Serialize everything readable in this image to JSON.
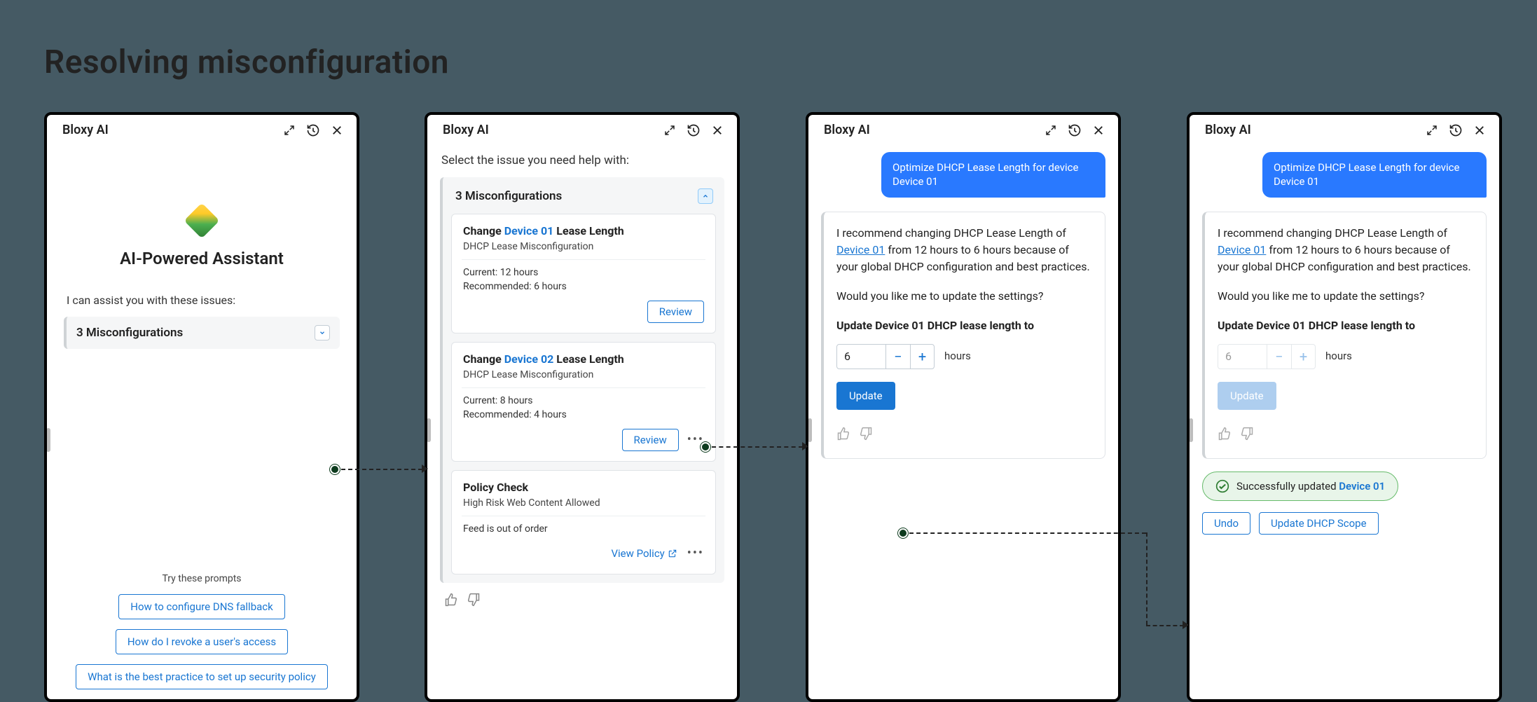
{
  "page_title": "Resolving misconfiguration",
  "header_title": "Bloxy AI",
  "panel1": {
    "assist_title": "AI-Powered Assistant",
    "assist_intro": "I can assist you with these issues:",
    "dropdown_label": "3 Misconfigurations",
    "prompts_heading": "Try these prompts",
    "prompts": [
      "How to configure DNS fallback",
      "How do I revoke a user's access",
      "What is the best practice to set up security policy"
    ]
  },
  "panel2": {
    "select_issue": "Select the issue you need help with:",
    "group_title": "3 Misconfigurations",
    "card1": {
      "pre": "Change ",
      "device": "Device 01",
      "post": " Lease Length",
      "sub": "DHCP Lease Misconfiguration",
      "current": "Current: 12 hours",
      "rec": "Recommended: 6 hours",
      "action": "Review"
    },
    "card2": {
      "pre": "Change ",
      "device": "Device 02",
      "post": " Lease Length",
      "sub": "DHCP Lease Misconfiguration",
      "current": "Current: 8 hours",
      "rec": "Recommended: 4 hours",
      "action": "Review"
    },
    "card3": {
      "title": "Policy Check",
      "sub": "High Risk Web Content Allowed",
      "note": "Feed is out of order",
      "action": "View Policy"
    }
  },
  "panel3": {
    "user_msg": "Optimize DHCP Lease Length for device Device 01",
    "ai_pre": "I recommend changing DHCP Lease Length of ",
    "ai_device": "Device 01",
    "ai_post": " from 12 hours to 6 hours because of your global DHCP configuration and best practices.",
    "ai_q": "Would you like me to update the settings?",
    "ai_heading": "Update Device 01 DHCP lease length to",
    "stepper_value": "6",
    "stepper_unit": "hours",
    "update_label": "Update"
  },
  "panel4": {
    "user_msg": "Optimize DHCP Lease Length for device Device 01",
    "ai_pre": "I recommend changing DHCP Lease Length of ",
    "ai_device": "Device 01",
    "ai_post": " from 12 hours to 6 hours because of your global DHCP configuration and best practices.",
    "ai_q": "Would you like me to update the settings?",
    "ai_heading": "Update Device 01 DHCP lease length to",
    "stepper_value": "6",
    "stepper_unit": "hours",
    "update_label": "Update",
    "success_pre": "Successfully updated ",
    "success_device": "Device 01",
    "undo_label": "Undo",
    "scope_label": "Update DHCP Scope"
  }
}
